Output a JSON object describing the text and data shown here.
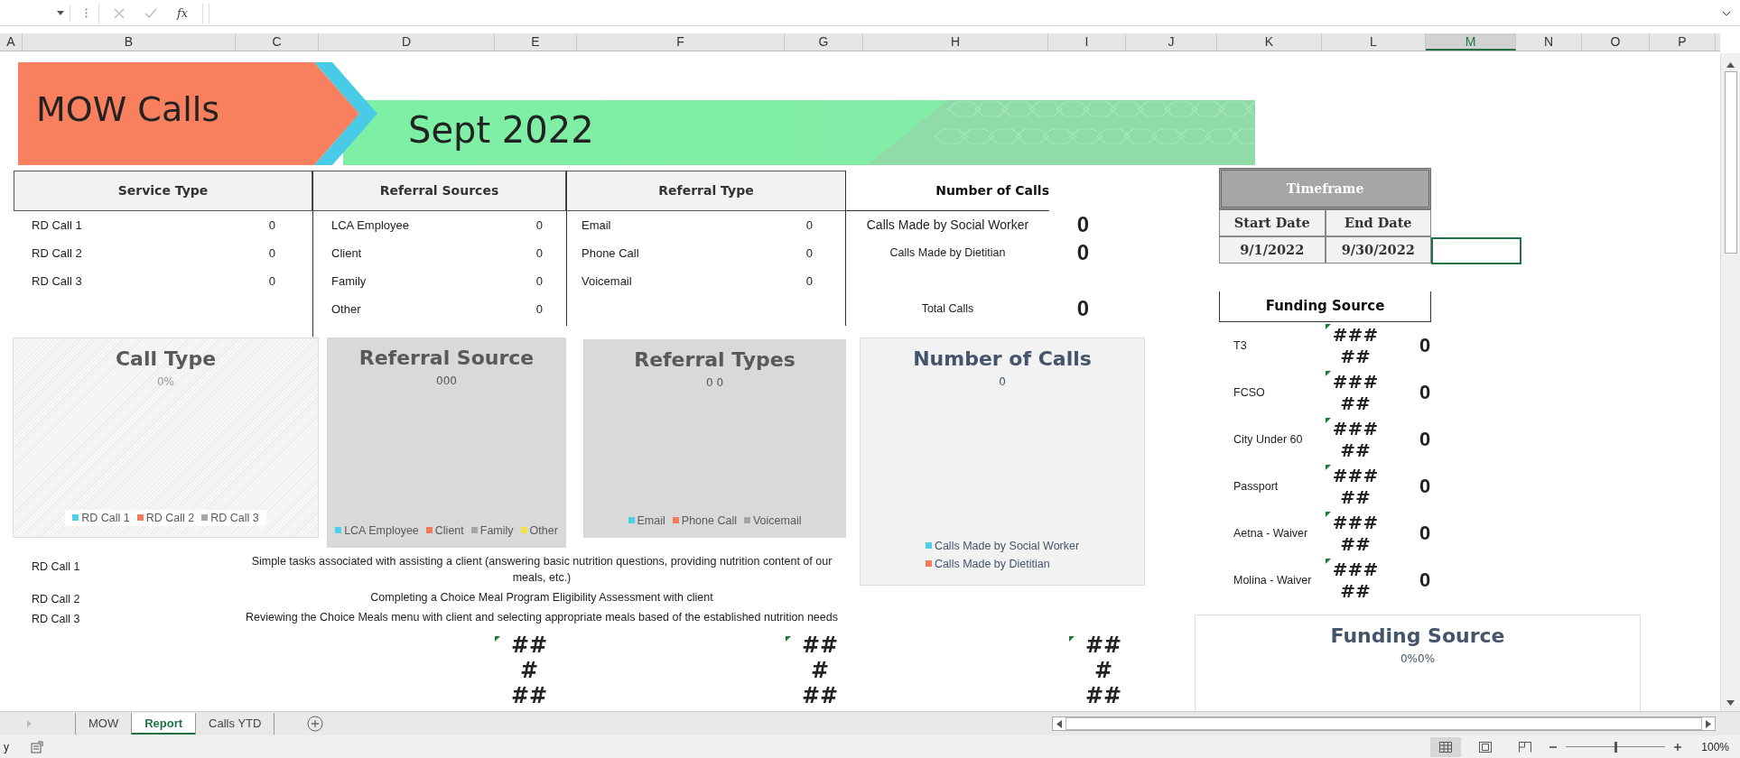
{
  "formula_bar": {
    "function_label": "fx"
  },
  "columns": [
    {
      "label": "A",
      "selected": false
    },
    {
      "label": "B",
      "selected": false
    },
    {
      "label": "C",
      "selected": false
    },
    {
      "label": "D",
      "selected": false
    },
    {
      "label": "E",
      "selected": false
    },
    {
      "label": "F",
      "selected": false
    },
    {
      "label": "G",
      "selected": false
    },
    {
      "label": "H",
      "selected": false
    },
    {
      "label": "I",
      "selected": false
    },
    {
      "label": "J",
      "selected": false
    },
    {
      "label": "K",
      "selected": false
    },
    {
      "label": "L",
      "selected": false
    },
    {
      "label": "M",
      "selected": true
    },
    {
      "label": "N",
      "selected": false
    },
    {
      "label": "O",
      "selected": false
    },
    {
      "label": "P",
      "selected": false
    }
  ],
  "banner": {
    "title": "MOW Calls",
    "subtitle": "Sept 2022"
  },
  "service_type": {
    "header": "Service Type",
    "rows": [
      {
        "label": "RD Call 1",
        "value": "0"
      },
      {
        "label": "RD Call 2",
        "value": "0"
      },
      {
        "label": "RD Call 3",
        "value": "0"
      }
    ]
  },
  "referral_sources": {
    "header": "Referral Sources",
    "rows": [
      {
        "label": "LCA Employee",
        "value": "0"
      },
      {
        "label": "Client",
        "value": "0"
      },
      {
        "label": "Family",
        "value": "0"
      },
      {
        "label": "Other",
        "value": "0"
      }
    ]
  },
  "referral_type": {
    "header": "Referral Type",
    "rows": [
      {
        "label": "Email",
        "value": "0"
      },
      {
        "label": "Phone Call",
        "value": "0"
      },
      {
        "label": "Voicemail",
        "value": "0"
      }
    ]
  },
  "number_of_calls": {
    "header": "Number of Calls",
    "rows": [
      {
        "label": "Calls Made by Social Worker",
        "value": "0"
      },
      {
        "label": "Calls Made by Dietitian",
        "value": "0"
      },
      {
        "label": "Total Calls",
        "value": "0"
      }
    ]
  },
  "timeframe": {
    "header": "Timeframe",
    "start_label": "Start Date",
    "end_label": "End Date",
    "start": "9/1/2022",
    "end": "9/30/2022"
  },
  "funding_source": {
    "header": "Funding Source",
    "rows": [
      {
        "label": "T3",
        "hash": "### ##",
        "value": "0"
      },
      {
        "label": "FCSO",
        "hash": "### ##",
        "value": "0"
      },
      {
        "label": "City Under 60",
        "hash": "### ##",
        "value": "0"
      },
      {
        "label": "Passport",
        "hash": "### ##",
        "value": "0"
      },
      {
        "label": "Aetna - Waiver",
        "hash": "### ##",
        "value": "0"
      },
      {
        "label": "Molina - Waiver",
        "hash": "### ##",
        "value": "0"
      }
    ]
  },
  "charts": [
    {
      "title": "Call Type",
      "data_label": "0%",
      "legend": [
        {
          "label": "RD Call 1",
          "color": "#4dd0e8"
        },
        {
          "label": "RD Call 2",
          "color": "#f4785a"
        },
        {
          "label": "RD Call 3",
          "color": "#a5a5a5"
        }
      ]
    },
    {
      "title": "Referral Source",
      "data_label": "000",
      "legend": [
        {
          "label": "LCA Employee",
          "color": "#4dd0e8"
        },
        {
          "label": "Client",
          "color": "#f4785a"
        },
        {
          "label": "Family",
          "color": "#a5a5a5"
        },
        {
          "label": "Other",
          "color": "#f2e24a"
        }
      ]
    },
    {
      "title": "Referral Types",
      "data_label": "0 0",
      "legend": [
        {
          "label": "Email",
          "color": "#4dd0e8"
        },
        {
          "label": "Phone Call",
          "color": "#f4785a"
        },
        {
          "label": "Voicemail",
          "color": "#a5a5a5"
        }
      ]
    },
    {
      "title": "Number of Calls",
      "data_label": "0",
      "legend": [
        {
          "label": "Calls Made by Social Worker",
          "color": "#4dd0e8"
        },
        {
          "label": "Calls Made by Dietitian",
          "color": "#f4785a"
        }
      ]
    },
    {
      "title": "Funding Source",
      "data_label": "0%0%"
    }
  ],
  "descriptions": [
    {
      "label": "RD Call 1",
      "text": "Simple tasks associated with assisting a client (answering basic nutrition questions, providing nutrition content of our meals, etc.)"
    },
    {
      "label": "RD Call 2",
      "text": "Completing a Choice Meal Program Eligibility Assessment with client"
    },
    {
      "label": "RD Call 3",
      "text": "Reviewing the Choice Meals menu with client and selecting appropriate meals based of the established nutrition needs"
    }
  ],
  "overflow_cells": [
    "## # ##",
    "## # ##",
    "## # ##"
  ],
  "sheet_tabs": [
    {
      "label": "MOW",
      "selected": false
    },
    {
      "label": "Report",
      "selected": true
    },
    {
      "label": "Calls YTD",
      "selected": false
    }
  ],
  "status": {
    "mode": "y",
    "zoom": "100%",
    "zoom_slider": {
      "level": 0.5
    }
  }
}
